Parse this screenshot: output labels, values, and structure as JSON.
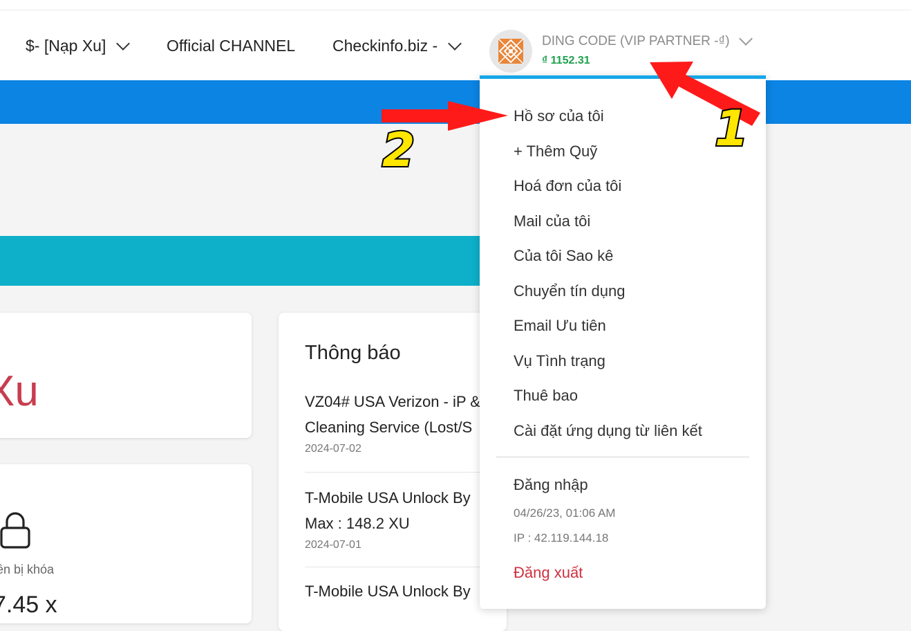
{
  "nav": {
    "topup_label": "$- [Nạp Xu]",
    "channel_label": "Official CHANNEL",
    "checkinfo_label": "Checkinfo.biz -",
    "account": {
      "name": "DING CODE (VIP PARTNER -₫)",
      "balance": "₫ 1152.31"
    }
  },
  "cards": {
    "balance_text": "Xu",
    "locked_label": "ền bị khóa",
    "locked_value": "7.45 x"
  },
  "notifications": {
    "title": "Thông báo",
    "items": [
      {
        "line1": "VZ04# USA Verizon - iP &",
        "line2": "Cleaning Service (Lost/S",
        "date": "2024-07-02"
      },
      {
        "line1": "T-Mobile USA Unlock By",
        "line2": "Max : 148.2 XU",
        "date": "2024-07-01"
      },
      {
        "line1": "T-Mobile USA Unlock By"
      }
    ]
  },
  "dropdown": {
    "items": [
      "Hồ sơ của tôi",
      "+ Thêm Quỹ",
      "Hoá đơn của tôi",
      "Mail của tôi",
      "Của tôi Sao kê",
      "Chuyển tín dụng",
      "Email Ưu tiên",
      "Vụ Tình trạng",
      "Thuê bao",
      "Cài đặt ứng dụng từ liên kết"
    ],
    "login_label": "Đăng nhập",
    "login_time": "04/26/23, 01:06 AM",
    "login_ip": "IP : 42.119.144.18",
    "logout_label": "Đăng xuất"
  },
  "annotations": {
    "arrow1_label": "1",
    "arrow2_label": "2"
  },
  "colors": {
    "primary_blue": "#0b84e3",
    "teal": "#0eafc9",
    "balance_green": "#1da14d",
    "logout_red": "#d0303f",
    "annotation_red": "#ff1a1a",
    "annotation_yellow": "#ffe600"
  }
}
